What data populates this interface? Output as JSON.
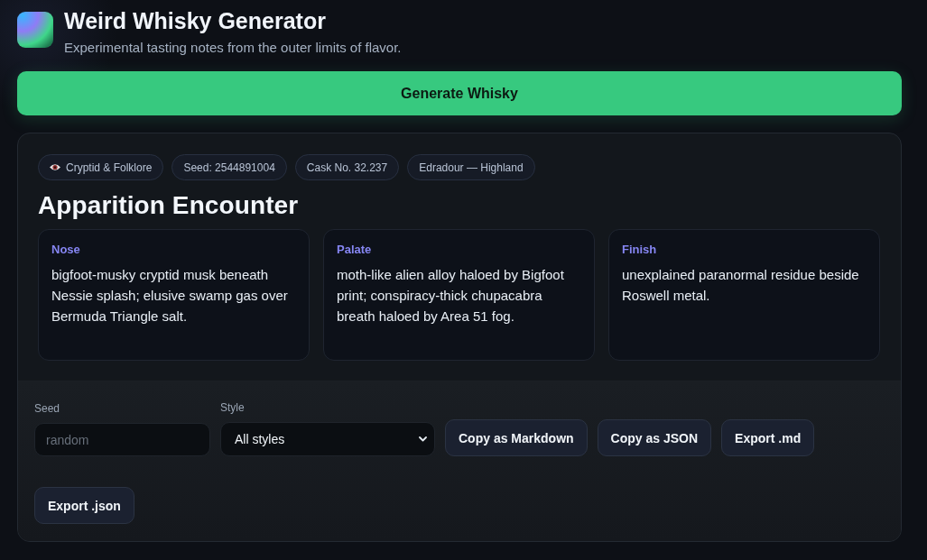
{
  "header": {
    "title": "Weird Whisky Generator",
    "subtitle": "Experimental tasting notes from the outer limits of flavor."
  },
  "generate_button": {
    "label": "Generate Whisky"
  },
  "result": {
    "tags": [
      {
        "kind": "style",
        "label": "Cryptid & Folklore"
      },
      {
        "kind": "meta",
        "label": "Seed: 2544891004"
      },
      {
        "kind": "meta",
        "label": "Cask No. 32.237"
      },
      {
        "kind": "meta",
        "label": "Edradour — Highland"
      }
    ],
    "name": "Apparition Encounter",
    "notes": [
      {
        "label": "Nose",
        "text": "bigfoot-musky cryptid musk beneath Nessie splash; elusive swamp gas over Bermuda Triangle salt."
      },
      {
        "label": "Palate",
        "text": "moth-like alien alloy haloed by Bigfoot print; conspiracy-thick chupacabra breath haloed by Area 51 fog."
      },
      {
        "label": "Finish",
        "text": "unexplained paranormal residue beside Roswell metal."
      }
    ]
  },
  "controls": {
    "seed": {
      "label": "Seed",
      "placeholder": "random"
    },
    "style": {
      "label": "Style",
      "value": "All styles"
    },
    "buttons": [
      "Copy as Markdown",
      "Copy as JSON",
      "Export .md",
      "Export .json"
    ]
  }
}
